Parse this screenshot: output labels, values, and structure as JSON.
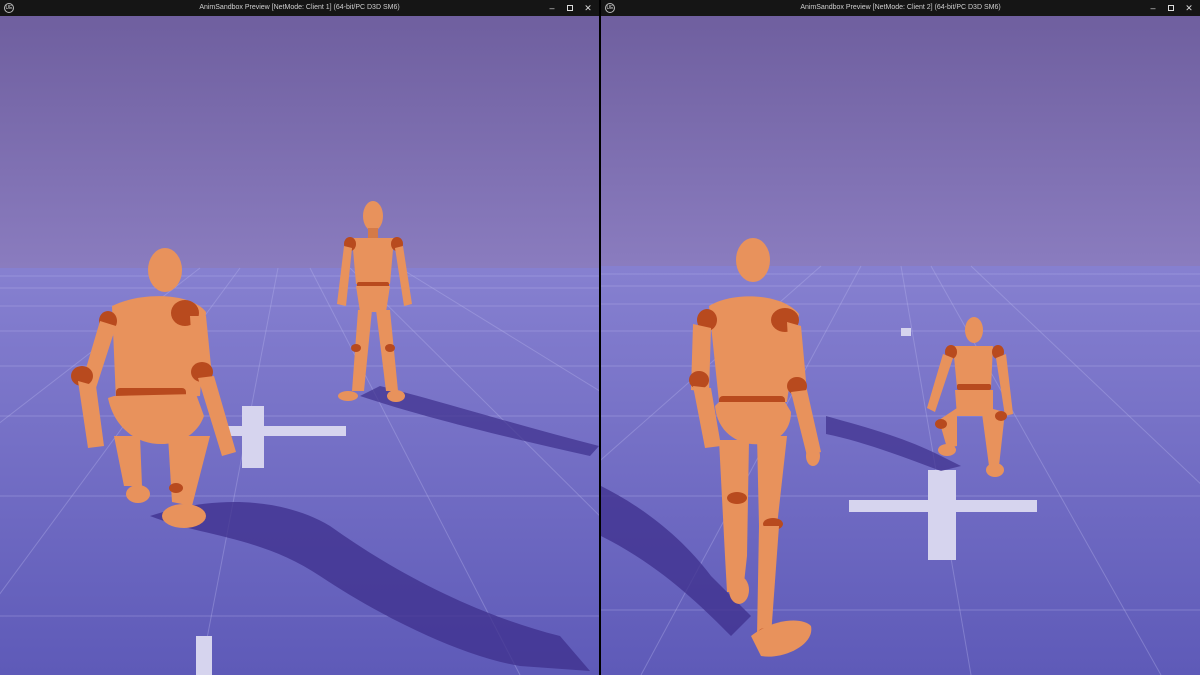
{
  "windows": [
    {
      "title": "AnimSandbox Preview [NetMode: Client 1]  (64-bit/PC D3D SM6)",
      "logo": "UE"
    },
    {
      "title": "AnimSandbox Preview [NetMode: Client 2]  (64-bit/PC D3D SM6)",
      "logo": "UE"
    }
  ],
  "controls": {
    "minimize": "–",
    "maximize": "□",
    "close": "✕"
  },
  "colors": {
    "sky_top": "#6f5fa0",
    "sky_horizon": "#8a7cc0",
    "floor": "#6a66c4",
    "mannequin": "#e8925c",
    "joints": "#b84a1e"
  }
}
